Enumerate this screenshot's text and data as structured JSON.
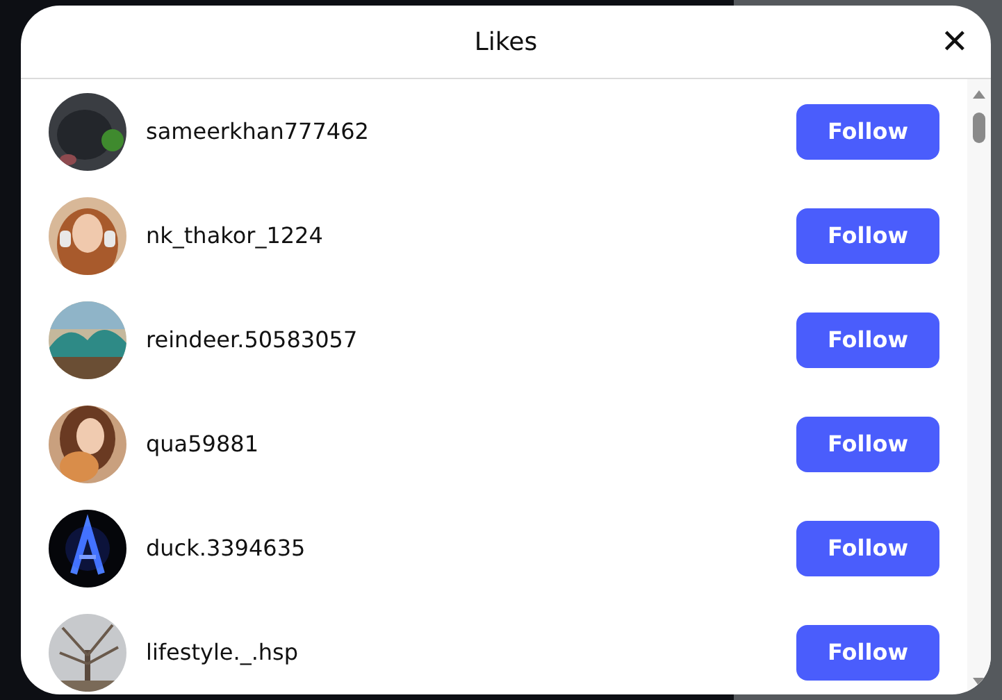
{
  "dialog": {
    "title": "Likes",
    "close": "✕"
  },
  "users": [
    {
      "username": "sameerkhan777462",
      "button": "Follow"
    },
    {
      "username": "nk_thakor_1224",
      "button": "Follow"
    },
    {
      "username": "reindeer.50583057",
      "button": "Follow"
    },
    {
      "username": "qua59881",
      "button": "Follow"
    },
    {
      "username": "duck.3394635",
      "button": "Follow"
    },
    {
      "username": "lifestyle._.hsp",
      "button": "Follow"
    }
  ]
}
